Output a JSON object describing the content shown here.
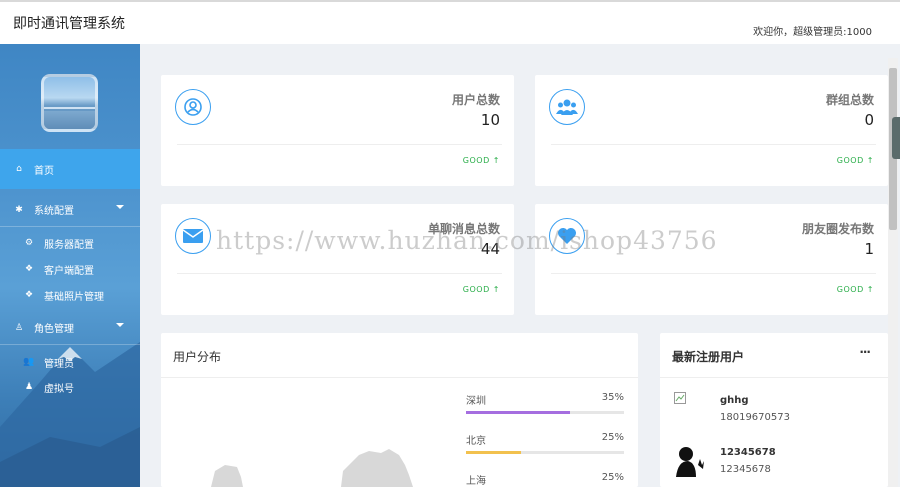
{
  "header": {
    "title": "即时通讯管理系统",
    "welcome": "欢迎你，超级管理员:1000"
  },
  "sidebar": {
    "home": "首页",
    "system_config": "系统配置",
    "server_config": "服务器配置",
    "client_config": "客户端配置",
    "photo_manage": "基础照片管理",
    "role_manage": "角色管理",
    "admin": "管理员",
    "virtual": "虚拟号"
  },
  "stats": [
    {
      "label": "用户总数",
      "value": "10",
      "status": "GOOD",
      "icon": "user-icon"
    },
    {
      "label": "群组总数",
      "value": "0",
      "status": "GOOD",
      "icon": "group-icon"
    },
    {
      "label": "单聊消息总数",
      "value": "44",
      "status": "GOOD",
      "icon": "mail-icon"
    },
    {
      "label": "朋友圈发布数",
      "value": "1",
      "status": "GOOD",
      "icon": "heart-icon"
    }
  ],
  "distribution": {
    "title": "用户分布",
    "rows": [
      {
        "city": "深圳",
        "pct": "35%",
        "fraction": 0.66,
        "color": "#a56ee0"
      },
      {
        "city": "北京",
        "pct": "25%",
        "fraction": 0.35,
        "color": "#f2c14e"
      },
      {
        "city": "上海",
        "pct": "25%",
        "fraction": 0.35,
        "color": "#3ea5ec"
      }
    ]
  },
  "newest_users": {
    "title": "最新注册用户",
    "more": "···",
    "users": [
      {
        "name": "ghhg",
        "phone": "18019670573"
      },
      {
        "name": "12345678",
        "phone": "12345678"
      }
    ]
  },
  "watermark": "https://www.huzhan.com/ishop43756"
}
